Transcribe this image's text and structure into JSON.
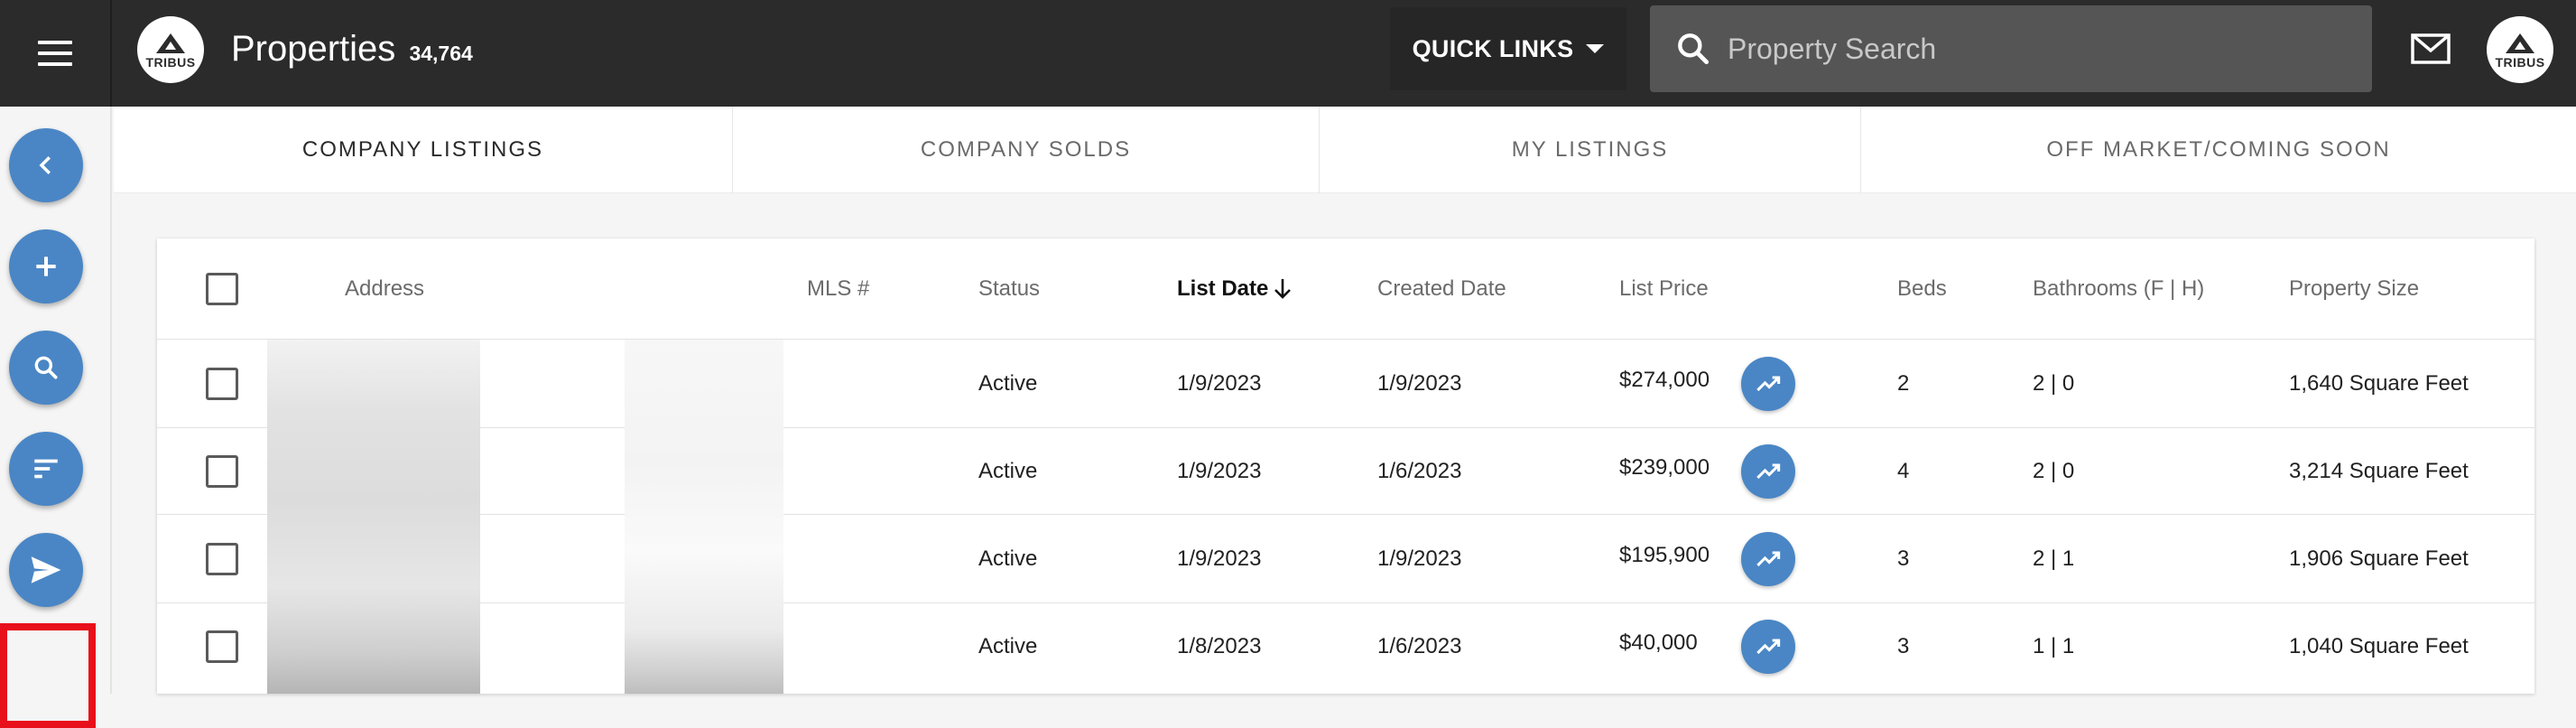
{
  "header": {
    "title": "Properties",
    "count": "34,764",
    "logo_text": "TRIBUS",
    "quick_links_label": "QUICK LINKS",
    "search_placeholder": "Property Search"
  },
  "rail": {
    "buttons": [
      "back",
      "add",
      "search",
      "sort",
      "send"
    ]
  },
  "tabs": [
    {
      "label": "COMPANY LISTINGS",
      "active": true
    },
    {
      "label": "COMPANY SOLDS",
      "active": false
    },
    {
      "label": "MY LISTINGS",
      "active": false
    },
    {
      "label": "OFF MARKET/COMING SOON",
      "active": false
    }
  ],
  "table": {
    "columns": {
      "address": "Address",
      "mls": "MLS #",
      "status": "Status",
      "list_date": "List Date",
      "created_date": "Created Date",
      "list_price": "List Price",
      "beds": "Beds",
      "bathrooms": "Bathrooms (F | H)",
      "size": "Property Size"
    },
    "sort": {
      "column": "List Date",
      "direction": "descending"
    },
    "rows": [
      {
        "status": "Active",
        "list_date": "1/9/2023",
        "created_date": "1/9/2023",
        "list_price": "$274,000",
        "beds": "2",
        "baths": "2 | 0",
        "size": "1,640 Square Feet"
      },
      {
        "status": "Active",
        "list_date": "1/9/2023",
        "created_date": "1/6/2023",
        "list_price": "$239,000",
        "beds": "4",
        "baths": "2 | 0",
        "size": "3,214 Square Feet"
      },
      {
        "status": "Active",
        "list_date": "1/9/2023",
        "created_date": "1/9/2023",
        "list_price": "$195,900",
        "beds": "3",
        "baths": "2 | 1",
        "size": "1,906 Square Feet"
      },
      {
        "status": "Active",
        "list_date": "1/8/2023",
        "created_date": "1/6/2023",
        "list_price": "$40,000",
        "beds": "3",
        "baths": "1 | 1",
        "size": "1,040 Square Feet"
      }
    ]
  },
  "colors": {
    "topbar": "#2b2b2b",
    "accent": "#4a86c5",
    "highlight": "#e8101a"
  }
}
